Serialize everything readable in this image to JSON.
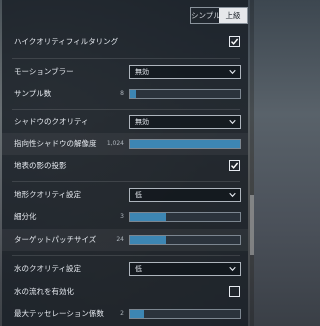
{
  "mode_toggle": {
    "simple_label": "シンプル",
    "advanced_label": "上級",
    "active": "上級"
  },
  "settings": {
    "hyqual_filter": {
      "label": "ハイクオリティフィルタリング",
      "checked": true
    },
    "motion_blur": {
      "label": "モーションブラー",
      "value": "無効"
    },
    "sample_count": {
      "label": "サンプル数",
      "value_text": "8",
      "fraction": 0.05
    },
    "shadow_quality": {
      "label": "シャドウのクオリティ",
      "value": "無効"
    },
    "directional_shadow_res": {
      "label": "指向性シャドウの解像度",
      "value_text": "1,024",
      "fraction": 1.0
    },
    "terrain_shadow": {
      "label": "地表の影の投影",
      "checked": true
    },
    "terrain_quality": {
      "label": "地形クオリティ設定",
      "value": "低"
    },
    "subdivision": {
      "label": "細分化",
      "value_text": "3",
      "fraction": 0.33
    },
    "target_patch_size": {
      "label": "ターゲットパッチサイズ",
      "value_text": "24",
      "fraction": 0.33
    },
    "water_quality": {
      "label": "水のクオリティ設定",
      "value": "低"
    },
    "water_flow": {
      "label": "水の流れを有効化",
      "checked": false
    },
    "max_tessellation": {
      "label": "最大テッセレーション係数",
      "value_text": "2",
      "fraction": 0.13
    }
  },
  "colors": {
    "accent": "#3d86b3",
    "panel_bg": "#181e26"
  }
}
